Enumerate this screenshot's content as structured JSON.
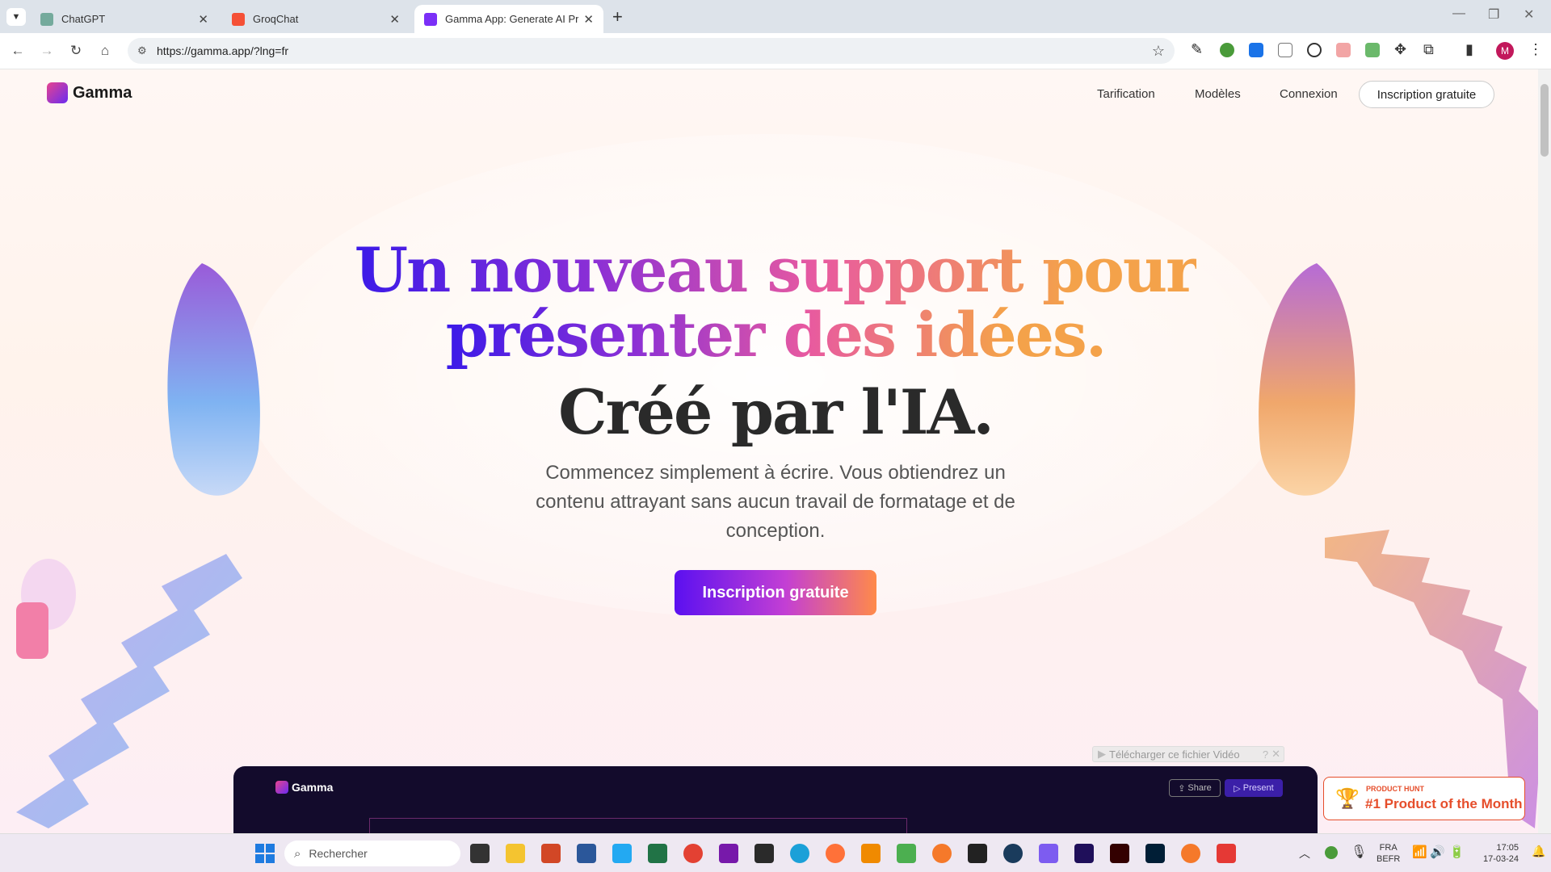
{
  "browser": {
    "tabs": [
      {
        "title": "ChatGPT",
        "active": false,
        "favicon_color": "#74aa9c"
      },
      {
        "title": "GroqChat",
        "active": false,
        "favicon_color": "#f55036"
      },
      {
        "title": "Gamma App: Generate AI Prese",
        "active": true,
        "favicon_color": "#7b2ff7"
      }
    ],
    "url": "https://gamma.app/?lng=fr",
    "profile_initial": "M"
  },
  "site": {
    "logo": "Gamma",
    "nav": {
      "pricing": "Tarification",
      "templates": "Modèles",
      "login": "Connexion",
      "signup": "Inscription gratuite"
    },
    "hero": {
      "line1": "Un nouveau support pour",
      "line2": "présenter des idées.",
      "line3": "Créé par l'IA.",
      "subtitle": "Commencez simplement à écrire. Vous obtiendrez un contenu attrayant sans aucun travail de formatage et de conception.",
      "cta": "Inscription gratuite"
    },
    "demo": {
      "logo": "Gamma",
      "share": "Share",
      "present": "Present"
    },
    "video_download": "Télécharger ce fichier Vidéo",
    "product_hunt": {
      "kicker": "PRODUCT HUNT",
      "title": "#1 Product of the Month"
    }
  },
  "taskbar": {
    "search_placeholder": "Rechercher",
    "lang": "FRA",
    "layout": "BEFR",
    "time": "17:05",
    "date": "17-03-24"
  },
  "colors": {
    "accent": "#5b10f0",
    "brand_gradient_end": "#ff8a4a",
    "product_hunt": "#e64e2b"
  }
}
